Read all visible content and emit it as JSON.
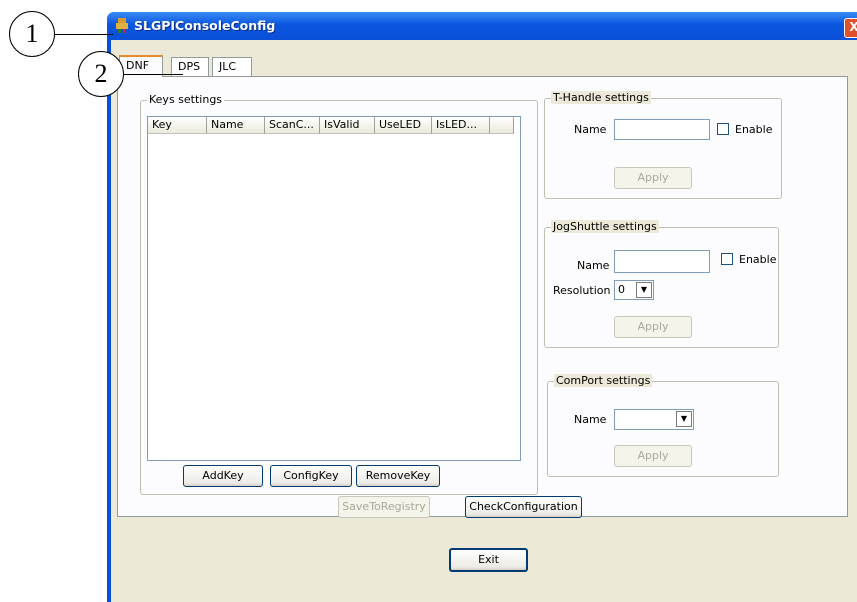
{
  "callouts": [
    "1",
    "2"
  ],
  "window": {
    "title": "SLGPIConsoleConfig",
    "close_glyph": "X",
    "icon": "app-icon"
  },
  "tabs": [
    {
      "label": "DNF"
    },
    {
      "label": "DPS"
    },
    {
      "label": "JLC"
    }
  ],
  "keys_settings": {
    "title": "Keys settings",
    "columns": [
      "Key",
      "Name",
      "ScanC...",
      "IsValid",
      "UseLED",
      "IsLED..."
    ],
    "buttons": {
      "add": "AddKey",
      "config": "ConfigKey",
      "remove": "RemoveKey"
    }
  },
  "bottom_buttons": {
    "save": "SaveToRegistry",
    "check": "CheckConfiguration"
  },
  "t_handle": {
    "title": "T-Handle settings",
    "name_label": "Name",
    "name_value": "",
    "enable_label": "Enable",
    "enable_checked": false,
    "apply": "Apply"
  },
  "jog_shuttle": {
    "title": "JogShuttle settings",
    "name_label": "Name",
    "name_value": "",
    "enable_label": "Enable",
    "enable_checked": false,
    "resolution_label": "Resolution",
    "resolution_value": "0",
    "apply": "Apply"
  },
  "com_port": {
    "title": "ComPort settings",
    "name_label": "Name",
    "name_value": "",
    "apply": "Apply"
  },
  "exit_button": "Exit",
  "colors": {
    "titlebar": "#0a4fd8",
    "dialog": "#ece9d8",
    "tab_highlight": "#e68b2c"
  }
}
